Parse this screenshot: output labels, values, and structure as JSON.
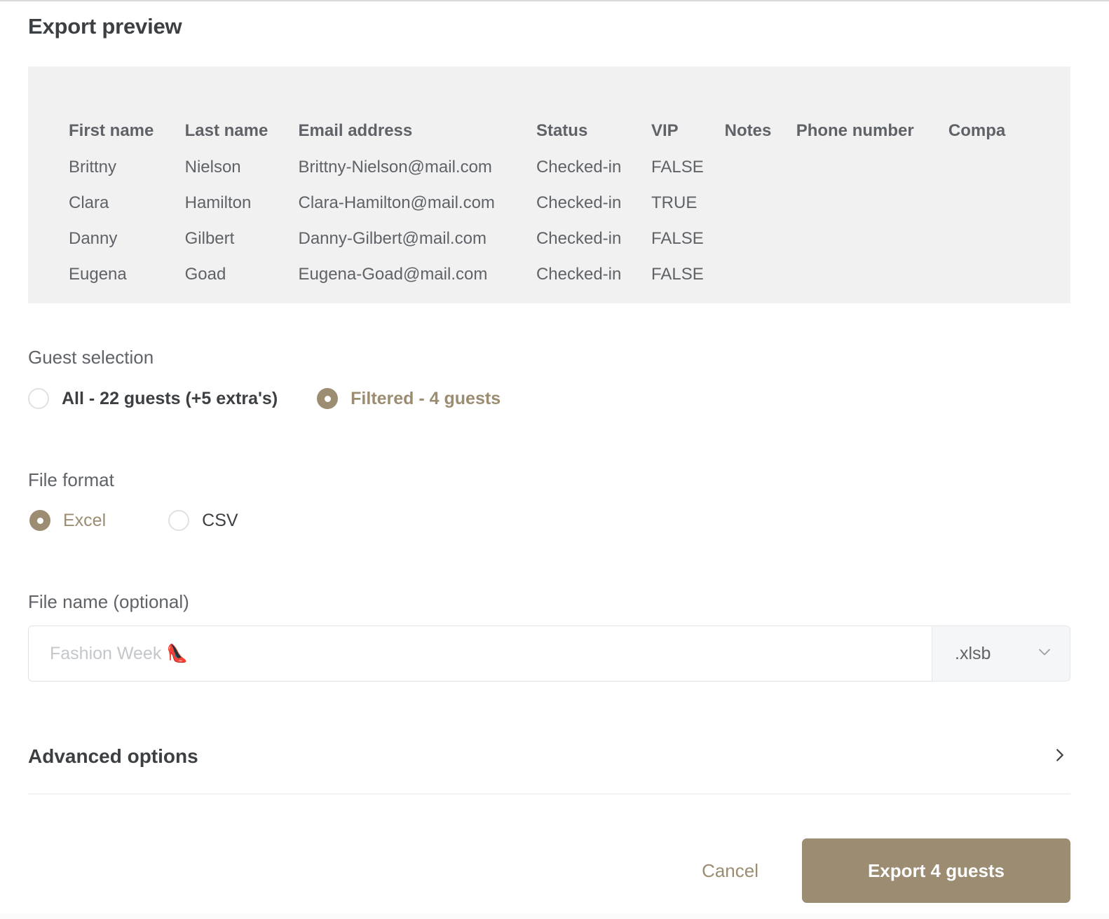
{
  "modal": {
    "title": "Export preview"
  },
  "preview": {
    "columns": [
      "First name",
      "Last name",
      "Email address",
      "Status",
      "VIP",
      "Notes",
      "Phone number",
      "Compa"
    ],
    "rows": [
      {
        "first_name": "Brittny",
        "last_name": "Nielson",
        "email": "Brittny-Nielson@mail.com",
        "status": "Checked-in",
        "vip": "FALSE",
        "notes": "",
        "phone": "",
        "company": ""
      },
      {
        "first_name": "Clara",
        "last_name": "Hamilton",
        "email": "Clara-Hamilton@mail.com",
        "status": "Checked-in",
        "vip": "TRUE",
        "notes": "",
        "phone": "",
        "company": ""
      },
      {
        "first_name": "Danny",
        "last_name": "Gilbert",
        "email": "Danny-Gilbert@mail.com",
        "status": "Checked-in",
        "vip": "FALSE",
        "notes": "",
        "phone": "",
        "company": ""
      },
      {
        "first_name": "Eugena",
        "last_name": "Goad",
        "email": "Eugena-Goad@mail.com",
        "status": "Checked-in",
        "vip": "FALSE",
        "notes": "",
        "phone": "",
        "company": ""
      }
    ]
  },
  "guest_selection": {
    "label": "Guest selection",
    "options": [
      {
        "label": "All - 22 guests (+5 extra's)",
        "selected": false
      },
      {
        "label": "Filtered - 4 guests",
        "selected": true
      }
    ]
  },
  "file_format": {
    "label": "File format",
    "options": [
      {
        "label": "Excel",
        "selected": true
      },
      {
        "label": "CSV",
        "selected": false
      }
    ]
  },
  "file_name": {
    "label": "File name (optional)",
    "value": "",
    "placeholder": "Fashion Week 👠",
    "extension": ".xlsb",
    "extension_icon": "chevron-down-icon"
  },
  "advanced_options": {
    "label": "Advanced options",
    "expand_icon": "chevron-right-icon"
  },
  "footer": {
    "cancel_label": "Cancel",
    "export_label": "Export 4 guests"
  },
  "colors": {
    "accent": "#9b8c72",
    "panel_bg": "#f1f1f1",
    "text_primary": "#3c4043",
    "text_secondary": "#5f6368"
  }
}
